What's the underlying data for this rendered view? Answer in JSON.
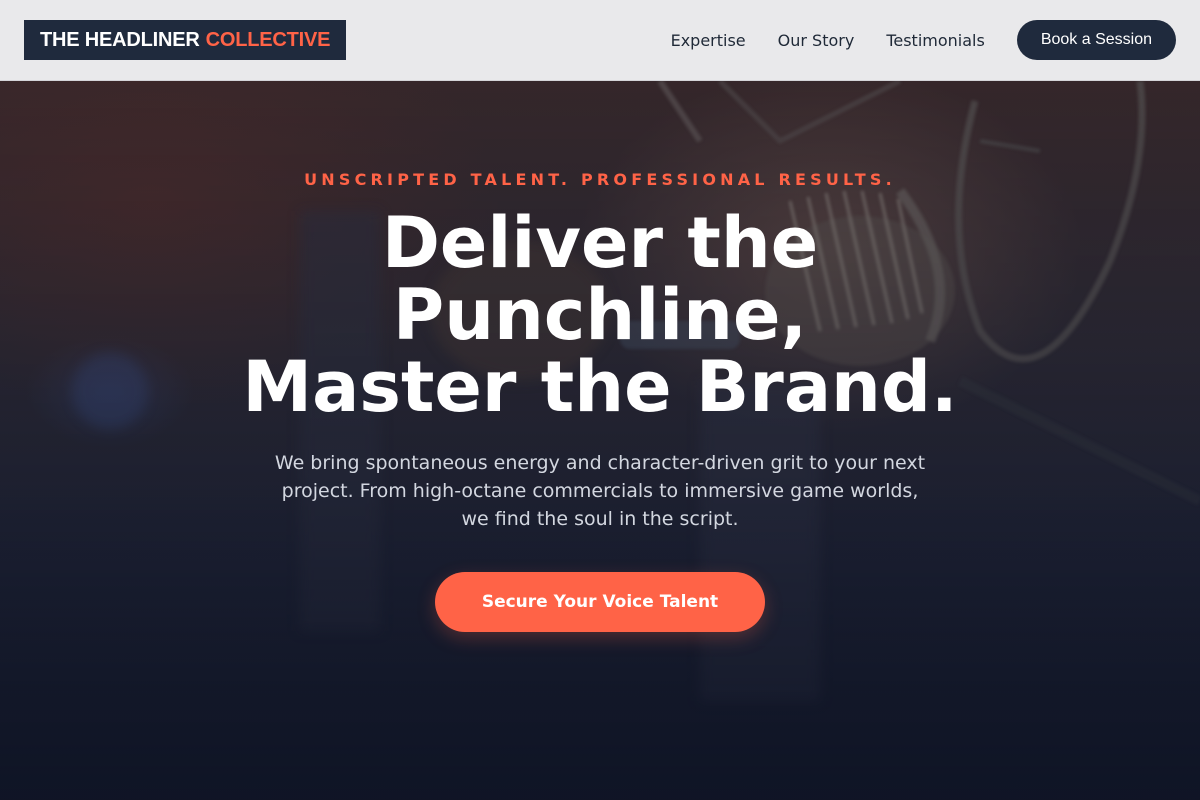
{
  "brand": {
    "name_part1": "THE HEADLINER",
    "name_part2": "COLLECTIVE"
  },
  "nav": {
    "links": [
      "Expertise",
      "Our Story",
      "Testimonials"
    ],
    "cta_label": "Book a Session"
  },
  "hero": {
    "eyebrow": "UNSCRIPTED TALENT. PROFESSIONAL RESULTS.",
    "headline_line1": "Deliver the",
    "headline_line2": "Punchline,",
    "headline_line3": "Master the Brand.",
    "subtext": "We bring spontaneous energy and character-driven grit to your next project. From high-octane commercials to immersive game worlds, we find the soul in the script.",
    "cta_label": "Secure Your Voice Talent",
    "background_image": "studio-microphone-icon"
  },
  "colors": {
    "accent": "#ff6347",
    "navy": "#1f2a3d",
    "nav_bg": "#e9e9eb"
  }
}
